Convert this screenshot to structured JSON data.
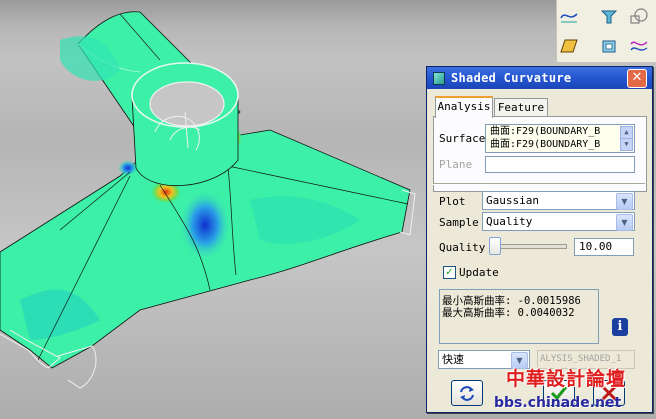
{
  "dialog": {
    "title": "Shaded Curvature",
    "close_glyph": "✕",
    "tabs": [
      {
        "label": "Analysis",
        "active": true
      },
      {
        "label": "Feature",
        "active": false
      }
    ],
    "surface": {
      "label": "Surface",
      "items": [
        "曲面:F29(BOUNDARY_B",
        "曲面:F29(BOUNDARY_B"
      ]
    },
    "plane": {
      "label": "Plane",
      "value": ""
    },
    "plot": {
      "label": "Plot",
      "value": "Gaussian"
    },
    "sample": {
      "label": "Sample",
      "value": "Quality"
    },
    "quality": {
      "label": "Quality",
      "value": "10.00",
      "slider_fraction": 0.0
    },
    "update": {
      "label": "Update",
      "checked": true
    },
    "results": {
      "min_line": "最小高斯曲率: -0.0015986",
      "max_line": "最大高斯曲率: 0.0040032"
    },
    "info_glyph": "i",
    "mode": {
      "value": "快速"
    },
    "analysis_name": "ALYSIS_SHADED_1"
  },
  "watermark": {
    "line1": "中華設計論壇",
    "line2": "bbs.chinade.net"
  },
  "icons": {
    "title": "shaded-curvature-icon",
    "toolbar": [
      "curve-analysis-icon",
      "draft-analysis-icon",
      "section-analysis-icon",
      "plane-analysis-icon",
      "shaded-box-icon",
      "curvature-graph-icon"
    ],
    "repaint": "repaint-arrows-icon",
    "ok": "ok-check-icon",
    "cancel": "cancel-x-icon"
  },
  "colors": {
    "title_bar": "#2456d0",
    "dialog_bg": "#ece9d8",
    "surface_fill": "#3cf0a8",
    "surface_high": "#d44a1a",
    "surface_low": "#1a3ad4"
  }
}
